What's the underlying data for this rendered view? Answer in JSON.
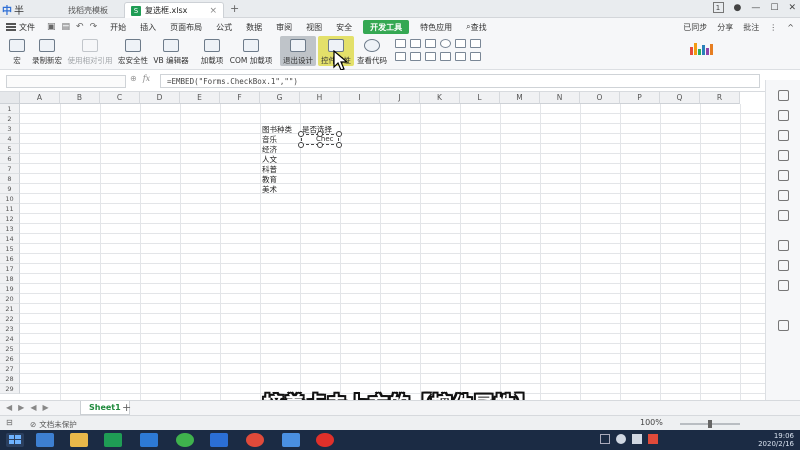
{
  "titlebar": {
    "ime_chars": [
      "中",
      "半"
    ],
    "tabs": [
      {
        "label": "找稻壳模板",
        "active": false
      },
      {
        "label": "复选框.xlsx",
        "active": true
      }
    ],
    "new_tab": "+",
    "badge": "1",
    "controls": [
      "—",
      "☐",
      "✕"
    ]
  },
  "menubar": {
    "file": "文件",
    "items": [
      "开始",
      "插入",
      "页面布局",
      "公式",
      "数据",
      "审阅",
      "视图",
      "安全",
      "开发工具",
      "特色应用"
    ],
    "active_item": "开发工具",
    "search": "查找",
    "right": [
      "已同步",
      "分享",
      "批注"
    ]
  },
  "ribbon": {
    "buttons": [
      {
        "label": "宏",
        "disabled": false
      },
      {
        "label": "录制新宏",
        "disabled": false
      },
      {
        "label": "使用相对引用",
        "disabled": true
      },
      {
        "label": "宏安全性",
        "disabled": false
      },
      {
        "label": "VB 编辑器",
        "disabled": false
      },
      {
        "label": "加载项",
        "disabled": false
      },
      {
        "label": "COM 加载项",
        "disabled": false
      },
      {
        "label": "退出设计",
        "disabled": false
      },
      {
        "label": "控件属性",
        "disabled": false
      },
      {
        "label": "查看代码",
        "disabled": false
      }
    ]
  },
  "formula": {
    "fx": "fx",
    "content": "=EMBED(\"Forms.CheckBox.1\",\"\")"
  },
  "sheet": {
    "columns": [
      "A",
      "B",
      "C",
      "D",
      "E",
      "F",
      "G",
      "H",
      "I",
      "J",
      "K",
      "L",
      "M",
      "N",
      "O",
      "P",
      "Q",
      "R"
    ],
    "rows": [
      "1",
      "2",
      "3",
      "4",
      "5",
      "6",
      "7",
      "8",
      "9",
      "10",
      "11",
      "12",
      "13",
      "14",
      "15",
      "16",
      "17",
      "18",
      "19",
      "20",
      "21",
      "22",
      "23",
      "24",
      "25",
      "26",
      "27",
      "28",
      "29"
    ],
    "cells": {
      "g3": "图书种类",
      "h3": "是否选择",
      "g4": "音乐",
      "g5": "经济",
      "g6": "人文",
      "g7": "科普",
      "g8": "教育",
      "g9": "美术"
    },
    "checkbox_label": "Chec"
  },
  "sheet_tabs": {
    "nav": [
      "◀",
      "▶",
      "◀",
      "▶"
    ],
    "active": "Sheet1",
    "add": "+"
  },
  "status": {
    "doc_protect": "文档未保护",
    "zoom": "100%"
  },
  "taskbar": {
    "time": "19:06",
    "date": "2020/2/16"
  },
  "subtitle": "接着点击上方的【控件属性】"
}
